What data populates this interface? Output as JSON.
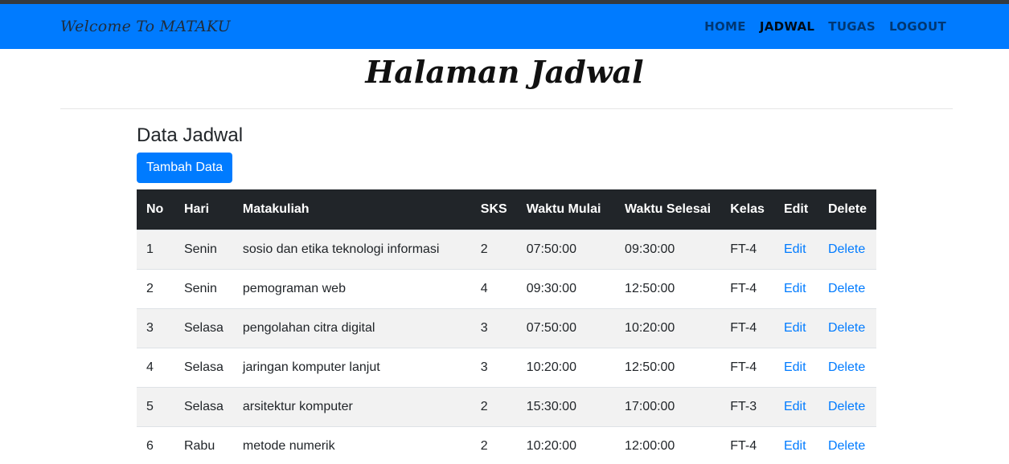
{
  "navbar": {
    "brand": "Welcome To MATAKU",
    "links": [
      {
        "label": "HOME",
        "active": false
      },
      {
        "label": "JADWAL",
        "active": true
      },
      {
        "label": "TUGAS",
        "active": false
      },
      {
        "label": "LOGOUT",
        "active": false
      }
    ]
  },
  "page_title": "Halaman Jadwal",
  "section": {
    "title": "Data Jadwal",
    "add_button": "Tambah Data"
  },
  "table": {
    "headers": [
      "No",
      "Hari",
      "Matakuliah",
      "SKS",
      "Waktu Mulai",
      "Waktu Selesai",
      "Kelas",
      "Edit",
      "Delete"
    ],
    "rows": [
      {
        "no": "1",
        "hari": "Senin",
        "matakuliah": "sosio dan etika teknologi informasi",
        "sks": "2",
        "mulai": "07:50:00",
        "selesai": "09:30:00",
        "kelas": "FT-4",
        "edit": "Edit",
        "delete": "Delete"
      },
      {
        "no": "2",
        "hari": "Senin",
        "matakuliah": "pemograman web",
        "sks": "4",
        "mulai": "09:30:00",
        "selesai": "12:50:00",
        "kelas": "FT-4",
        "edit": "Edit",
        "delete": "Delete"
      },
      {
        "no": "3",
        "hari": "Selasa",
        "matakuliah": "pengolahan citra digital",
        "sks": "3",
        "mulai": "07:50:00",
        "selesai": "10:20:00",
        "kelas": "FT-4",
        "edit": "Edit",
        "delete": "Delete"
      },
      {
        "no": "4",
        "hari": "Selasa",
        "matakuliah": "jaringan komputer lanjut",
        "sks": "3",
        "mulai": "10:20:00",
        "selesai": "12:50:00",
        "kelas": "FT-4",
        "edit": "Edit",
        "delete": "Delete"
      },
      {
        "no": "5",
        "hari": "Selasa",
        "matakuliah": "arsitektur komputer",
        "sks": "2",
        "mulai": "15:30:00",
        "selesai": "17:00:00",
        "kelas": "FT-3",
        "edit": "Edit",
        "delete": "Delete"
      },
      {
        "no": "6",
        "hari": "Rabu",
        "matakuliah": "metode numerik",
        "sks": "2",
        "mulai": "10:20:00",
        "selesai": "12:00:00",
        "kelas": "FT-4",
        "edit": "Edit",
        "delete": "Delete"
      }
    ]
  },
  "colors": {
    "primary": "#007bff",
    "table_header": "#212529",
    "stripe": "#f2f2f2"
  }
}
